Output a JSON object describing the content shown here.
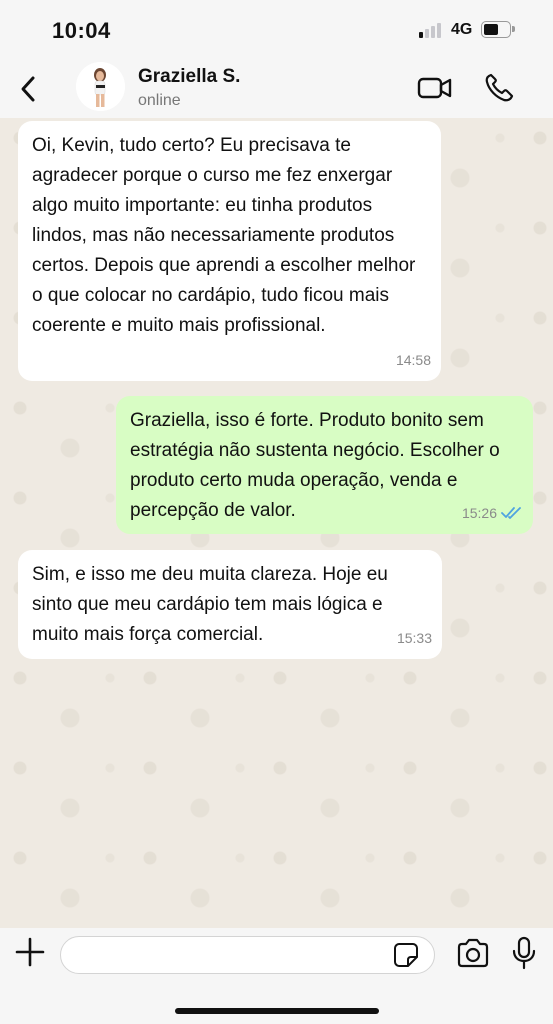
{
  "status_bar": {
    "time": "10:04",
    "network": "4G",
    "signal_bars_on": 1,
    "signal_bars_total": 4,
    "battery_level": 0.6
  },
  "header": {
    "contact_name": "Graziella S.",
    "contact_status": "online",
    "icons": [
      "chevron-left-icon",
      "avatar",
      "video-call-icon",
      "phone-icon"
    ]
  },
  "messages": [
    {
      "direction": "incoming",
      "text": "Oi, Kevin, tudo certo? Eu precisava te agradecer porque o curso me fez enxergar algo muito importante: eu tinha produtos lindos, mas não necessariamente produtos certos. Depois que aprendi a escolher melhor o que colocar no cardápio, tudo ficou mais coerente e muito mais profissional.",
      "time": "14:58"
    },
    {
      "direction": "outgoing",
      "text": "Graziella, isso é forte. Produto bonito sem estratégia não sustenta negócio. Escolher o produto certo muda operação, venda e percepção de valor.",
      "time": "15:26",
      "read": true
    },
    {
      "direction": "incoming",
      "text": "Sim, e isso me deu muita clareza. Hoje eu sinto que meu cardápio tem mais lógica e muito mais força comercial.",
      "time": "15:33"
    }
  ],
  "input_bar": {
    "placeholder": "",
    "value": "",
    "icons": [
      "plus-icon",
      "sticker-icon",
      "camera-icon",
      "microphone-icon"
    ]
  },
  "colors": {
    "incoming_bubble": "#ffffff",
    "outgoing_bubble": "#d8fdc4",
    "read_ticks": "#4fa3e0",
    "chat_background": "#efeae2"
  }
}
